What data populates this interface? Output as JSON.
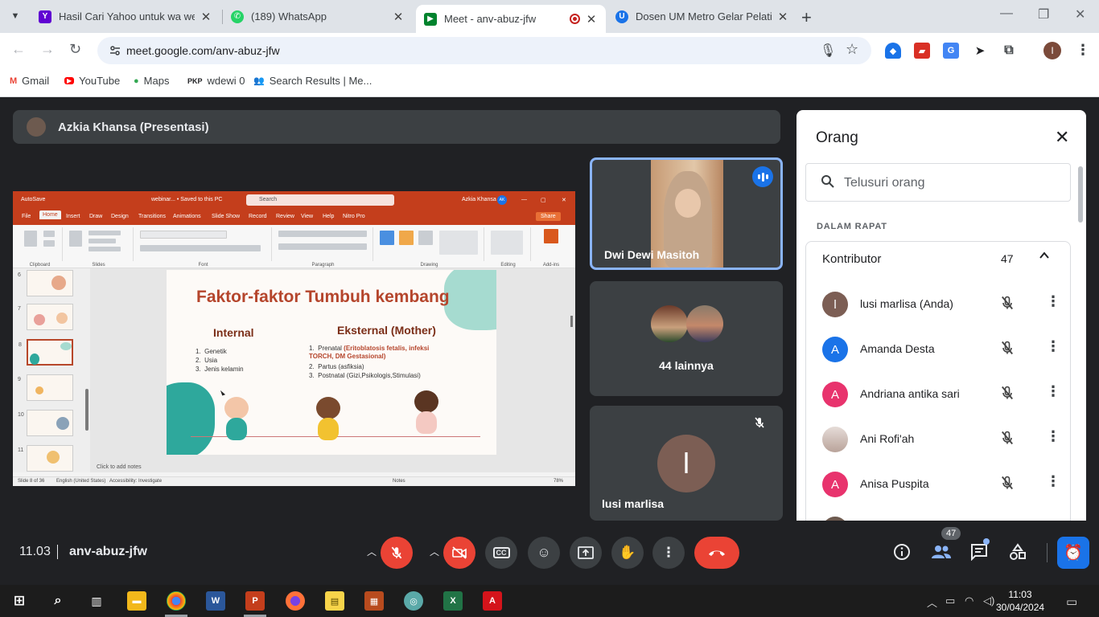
{
  "browser": {
    "tabs": [
      {
        "title": "Hasil Cari Yahoo untuk wa web",
        "favicon": "yahoo-icon",
        "color": "#6001d2"
      },
      {
        "title": "(189) WhatsApp",
        "favicon": "whatsapp-icon",
        "color": "#25d366"
      },
      {
        "title": "Meet - anv-abuz-jfw",
        "favicon": "meet-icon",
        "color": "#00832d",
        "active": true
      },
      {
        "title": "Dosen UM Metro Gelar Pelatiha",
        "favicon": "site-icon",
        "color": "#1a73e8"
      }
    ],
    "url": "meet.google.com/anv-abuz-jfw",
    "profile_initial": "I",
    "bookmarks": [
      "Gmail",
      "YouTube",
      "Maps",
      "wdewi 0",
      "Search Results | Me..."
    ],
    "bookmark_prefix_pkp": "PKP"
  },
  "meet": {
    "presenter_name": "Azkia Khansa (Presentasi)",
    "presentation": {
      "app_title": "webinar... • Saved to this PC",
      "autosave": "AutoSave",
      "search": "Search",
      "user": "Azkia Khansa",
      "user_initials": "AK",
      "menu": [
        "File",
        "Home",
        "Insert",
        "Draw",
        "Design",
        "Transitions",
        "Animations",
        "Slide Show",
        "Record",
        "Review",
        "View",
        "Help",
        "Nitro Pro"
      ],
      "share": "Share",
      "ribbon_groups": [
        "Clipboard",
        "Slides",
        "Font",
        "Paragraph",
        "Drawing",
        "Editing",
        "Add-ins"
      ],
      "thumb_numbers": [
        "6",
        "7",
        "8",
        "9",
        "10",
        "11"
      ],
      "slide": {
        "title": "Faktor-faktor Tumbuh kembang",
        "internal_heading": "Internal",
        "internal_items": [
          "Genetik",
          "Usia",
          "Jenis kelamin"
        ],
        "external_heading": "Eksternal (Mother)",
        "external_items": [
          {
            "label": "Prenatal",
            "detail": "(Eritoblatosis fetalis, infeksi TORCH, DM Gestasional)"
          },
          {
            "label": "Partus",
            "detail": "(asfiksia)"
          },
          {
            "label": "Postnatal",
            "detail": "(Gizi,Psikologis,Stimulasi)"
          }
        ]
      },
      "notes_placeholder": "Click to add notes",
      "status": {
        "slide": "Slide 8 of 36",
        "lang": "English (United States)",
        "access": "Accessibility: Investigate",
        "notes": "Notes",
        "zoom": "78%"
      }
    },
    "participants": [
      {
        "name": "Dwi Dewi Masitoh",
        "speaking": true
      },
      {
        "name": "44 lainnya"
      },
      {
        "name": "lusi marlisa",
        "initial": "l",
        "muted": true
      }
    ],
    "people_panel": {
      "title": "Orang",
      "search_placeholder": "Telusuri orang",
      "section": "DALAM RAPAT",
      "group": "Kontributor",
      "group_count": "47",
      "people": [
        {
          "name": "lusi marlisa (Anda)",
          "initial": "l",
          "color": "#7c5e54"
        },
        {
          "name": "Amanda Desta",
          "initial": "A",
          "color": "#1a73e8"
        },
        {
          "name": "Andriana antika sari",
          "initial": "A",
          "color": "#e8336d"
        },
        {
          "name": "Ani Rofi'ah",
          "initial": "",
          "color": "#c9b8b0"
        },
        {
          "name": "Anisa Puspita",
          "initial": "A",
          "color": "#e8336d"
        }
      ]
    },
    "controls": {
      "time": "11.03",
      "meeting_code": "anv-abuz-jfw",
      "people_badge": "47"
    }
  },
  "taskbar": {
    "time": "11:03",
    "date": "30/04/2024"
  }
}
